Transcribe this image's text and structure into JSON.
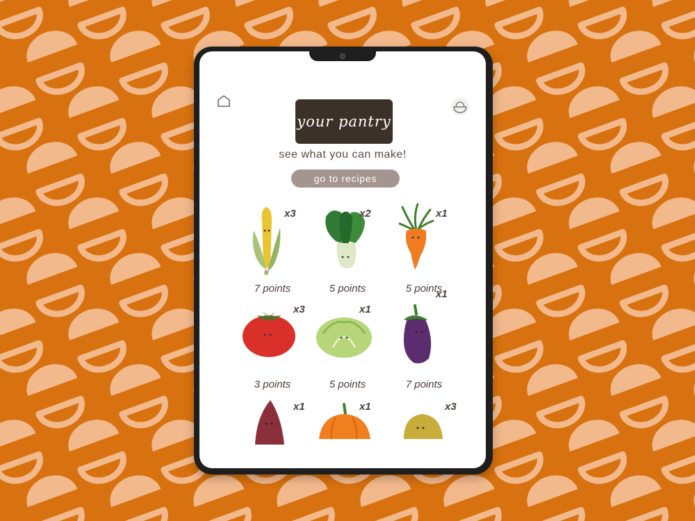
{
  "header": {
    "title": "your pantry",
    "subtitle": "see what you can make!",
    "recipes_button": "go to recipes"
  },
  "icons": {
    "home": "home-icon",
    "bowl": "bowl-icon"
  },
  "colors": {
    "background": "#d8710f",
    "pattern": "#f2b98c",
    "title_badge": "#3b3128",
    "button": "#a59590",
    "text": "#4a3f3a"
  },
  "pantry": [
    {
      "name": "corn",
      "quantity": "x3",
      "points": "7 points"
    },
    {
      "name": "bok choy",
      "quantity": "x2",
      "points": "5 points"
    },
    {
      "name": "carrot",
      "quantity": "x1",
      "points": "5 points"
    },
    {
      "name": "tomato",
      "quantity": "x3",
      "points": "3 points"
    },
    {
      "name": "cabbage",
      "quantity": "x1",
      "points": "5 points"
    },
    {
      "name": "eggplant",
      "quantity": "x1",
      "points": "7 points"
    },
    {
      "name": "sweet potato",
      "quantity": "x1",
      "points": ""
    },
    {
      "name": "pumpkin",
      "quantity": "x1",
      "points": ""
    },
    {
      "name": "potato",
      "quantity": "x3",
      "points": ""
    }
  ]
}
